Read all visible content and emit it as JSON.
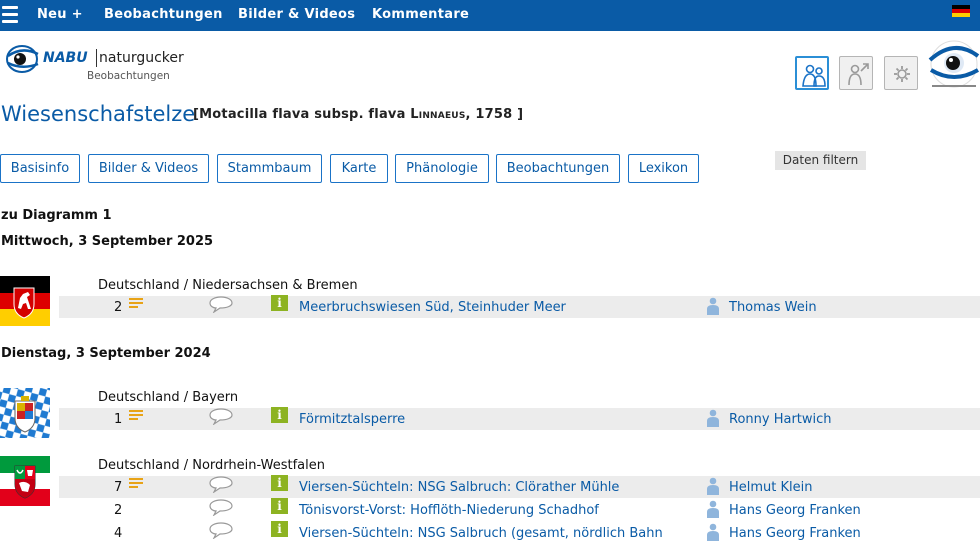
{
  "nav": {
    "menu_icon": "hamburger-icon",
    "items": [
      "Neu +",
      "Beobachtungen",
      "Bilder & Videos",
      "Kommentare"
    ],
    "language_flag": "flag-germany-icon"
  },
  "brand": {
    "nabu": "NABU",
    "naturgucker": "naturgucker",
    "subtitle": "Beobachtungen"
  },
  "header_icons": [
    "community-icon",
    "profile-icon",
    "settings-icon"
  ],
  "species": {
    "name": "Wiesenschafstelze",
    "scientific_prefix": "[Motacilla flava subsp. flava ",
    "author": "Linnaeus",
    "scientific_suffix": ", 1758 ]"
  },
  "tabs": [
    "Basisinfo",
    "Bilder & Videos",
    "Stammbaum",
    "Karte",
    "Phänologie",
    "Beobachtungen",
    "Lexikon"
  ],
  "filter_label": "Daten filtern",
  "diagram_link": "zu Diagramm 1",
  "days": [
    {
      "date": "Mittwoch, 3 September 2025",
      "regions": [
        {
          "label": "Deutschland / Niedersachsen & Bremen",
          "flag": "flag-niedersachsen-icon",
          "rows": [
            {
              "count": "2",
              "has_list": true,
              "place": "Meerbruchswiesen Süd, Steinhuder Meer",
              "observer": "Thomas Wein"
            }
          ]
        }
      ]
    },
    {
      "date": "Dienstag, 3 September 2024",
      "regions": [
        {
          "label": "Deutschland / Bayern",
          "flag": "flag-bayern-icon",
          "rows": [
            {
              "count": "1",
              "has_list": true,
              "place": "Förmitztalsperre",
              "observer": "Ronny Hartwich"
            }
          ]
        },
        {
          "label": "Deutschland / Nordrhein-Westfalen",
          "flag": "flag-nrw-icon",
          "rows": [
            {
              "count": "7",
              "has_list": true,
              "place": "Viersen-Süchteln: NSG Salbruch: Clörather Mühle",
              "observer": "Helmut Klein"
            },
            {
              "count": "2",
              "has_list": false,
              "place": "Tönisvorst-Vorst: Hofflöth-Niederung Schadhof",
              "observer": "Hans Georg Franken"
            },
            {
              "count": "4",
              "has_list": false,
              "place": "Viersen-Süchteln: NSG Salbruch (gesamt, nördlich Bahn",
              "observer": "Hans Georg Franken"
            }
          ]
        }
      ]
    }
  ],
  "colors": {
    "topbar": "#0a5ba6",
    "link": "#0a5ba6",
    "info": "#8db322",
    "list": "#e8a317"
  }
}
